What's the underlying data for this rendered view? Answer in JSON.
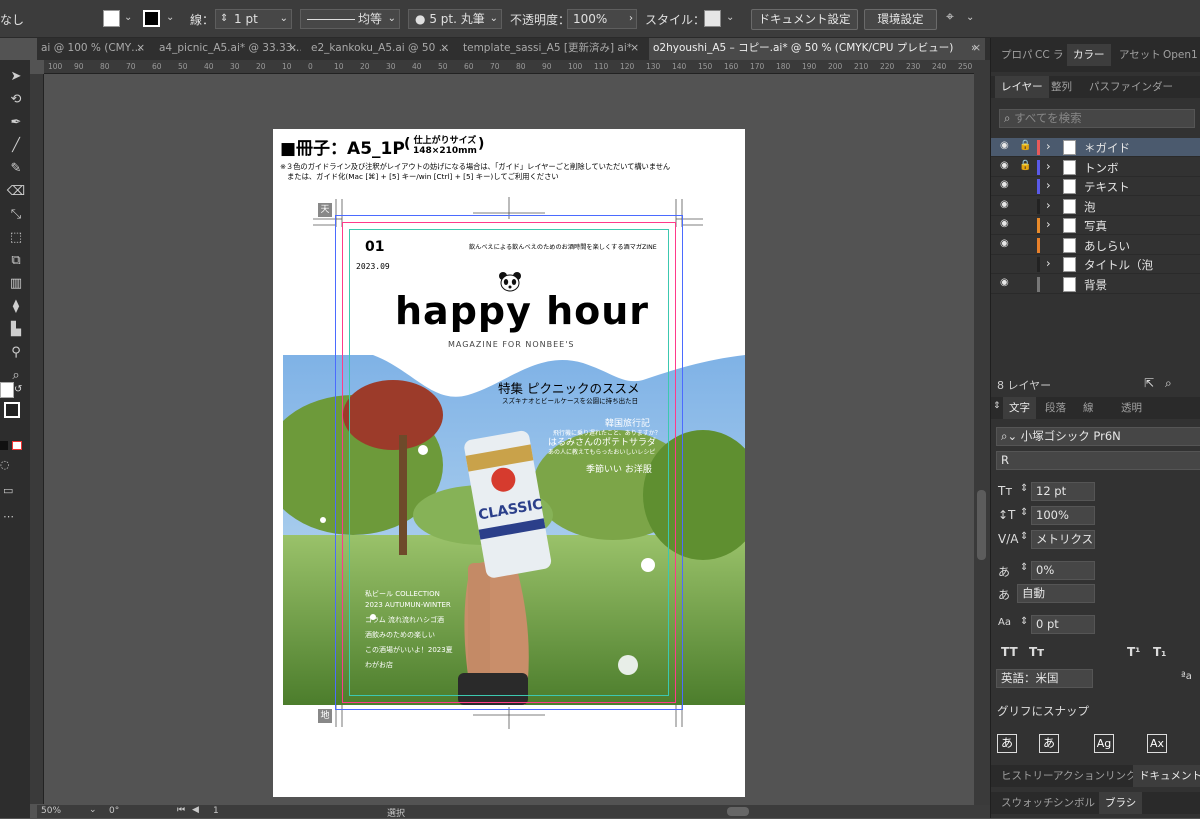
{
  "control_bar": {
    "selection_label": "なし",
    "stroke_label": "線：",
    "stroke_weight": "1 pt",
    "stroke_profile": "均等",
    "brush": "5 pt. 丸筆",
    "opacity_label": "不透明度：",
    "opacity_value": "100%",
    "style_label": "スタイル：",
    "doc_setup_button": "ドキュメント設定",
    "prefs_button": "環境設定"
  },
  "tabs": [
    {
      "label": "ai @ 100 % (CMY…",
      "active": false
    },
    {
      "label": "a4_picnic_A5.ai* @ 33.33…",
      "active": false
    },
    {
      "label": "e2_kankoku_A5.ai @ 50 …",
      "active": false
    },
    {
      "label": "template_sassi_A5 [更新済み] ai*",
      "active": false
    },
    {
      "label": "o2hyoushi_A5 – コピー.ai* @ 50 % (CMYK/CPU プレビュー)",
      "active": true
    }
  ],
  "ruler_ticks": [
    "100",
    "90",
    "80",
    "70",
    "60",
    "50",
    "40",
    "30",
    "20",
    "10",
    "0",
    "10",
    "20",
    "30",
    "40",
    "50",
    "60",
    "70",
    "80",
    "90",
    "100",
    "110",
    "120",
    "130",
    "140",
    "150",
    "160",
    "170",
    "180",
    "190",
    "200",
    "210",
    "220",
    "230",
    "240",
    "250"
  ],
  "artboard": {
    "heading": "■冊子：A5_1P",
    "size_top": "仕上がりサイズ",
    "size_bottom": "148×210mm",
    "note1": "※３色のガイドライン及び注釈がレイアウトの妨げになる場合は、「ガイド」レイヤーごと削除していただいて構いません",
    "note2": "または、ガイド化(Mac [⌘] + [5] キー/win [Ctrl] + [5] キー)してご利用ください",
    "top_mark": "天",
    "bottom_mark": "地",
    "issue": "01",
    "date": "2023.09",
    "tagline": "飲んべえによる飲んべえのためのお酒時間を楽しくする酒マガZINE",
    "title": "happy hour",
    "subtitle": "MAGAZINE FOR NONBEE'S",
    "feature_title": "特集 ピクニックのススメ",
    "feature_sub": "スズキナオとビールケースを公園に持ち出た日",
    "story1_title": "韓国旅行記",
    "story1_sub": "飛行機に乗り遅れたこと、ありますか？",
    "story2_title": "はるみさんのポテトサラダ",
    "story2_sub": "あの人に教えてもらったおいしいレシピ",
    "story3_title": "季節いい お洋服",
    "can_brand": "CLASSIC",
    "bottom_items": [
      "私ビール COLLECTION",
      "2023 AUTUMUN-WINTER",
      "ゴラム 流れ流れハシゴ酒",
      "酒飲みのための楽しい",
      "この酒場がいいよ！2023夏",
      "わがお店"
    ]
  },
  "layers_panel": {
    "tabs": [
      "レイヤー",
      "整列",
      "パスファインダー"
    ],
    "search_placeholder": "すべてを検索",
    "layers": [
      {
        "name": "＊ガイド",
        "color": "#e85a5a",
        "visible": true,
        "locked": true,
        "expand": true,
        "selected": true
      },
      {
        "name": "トンボ",
        "color": "#5a5ae8",
        "visible": true,
        "locked": true,
        "expand": true,
        "selected": false
      },
      {
        "name": "テキスト",
        "color": "#5a5ae8",
        "visible": true,
        "locked": false,
        "expand": true,
        "selected": false
      },
      {
        "name": "泡",
        "color": "#222222",
        "visible": true,
        "locked": false,
        "expand": true,
        "selected": false
      },
      {
        "name": "写真",
        "color": "#e88a2a",
        "visible": true,
        "locked": false,
        "expand": true,
        "selected": false
      },
      {
        "name": "あしらい",
        "color": "#e8802a",
        "visible": true,
        "locked": false,
        "expand": false,
        "selected": false
      },
      {
        "name": "タイトル（泡",
        "color": "#222222",
        "visible": false,
        "locked": false,
        "expand": true,
        "selected": false
      },
      {
        "name": "背景",
        "color": "#777777",
        "visible": true,
        "locked": false,
        "expand": false,
        "selected": false
      }
    ],
    "count": "8 レイヤー"
  },
  "top_panel_tabs": [
    "プロパ",
    "CC ラ",
    "カラー",
    "アセット",
    "Open1"
  ],
  "character_panel": {
    "tabs": [
      "文字",
      "段落",
      "線",
      "透明"
    ],
    "font_family": "小塚ゴシック Pr6N",
    "font_style": "R",
    "size": "12 pt",
    "scale": "100%",
    "kerning": "メトリクス",
    "tracking": "0%",
    "leading": "自動",
    "baseline": "0 pt",
    "language": "英語：米国",
    "snap_label": "グリフにスナップ"
  },
  "bottom_tabs_1": [
    "ヒストリー",
    "アクション",
    "リンク",
    "ドキュメント情"
  ],
  "bottom_tabs_2": [
    "スウォッチ",
    "シンボル",
    "ブラシ"
  ],
  "status": {
    "zoom": "50%",
    "rotation": "0°",
    "page": "1",
    "tool": "選択"
  }
}
